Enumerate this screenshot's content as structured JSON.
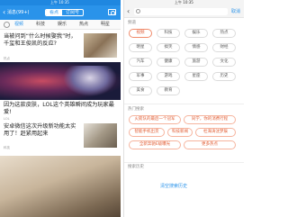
{
  "left": {
    "status_time": "上午 10:35",
    "header": {
      "message_label": "消息(99+)",
      "tabs": [
        "看点",
        "订阅号"
      ]
    },
    "categories": [
      "视频",
      "科技",
      "娱乐",
      "热点",
      "明星"
    ],
    "articles": [
      {
        "title": "当被问到“什么时候娶我”时，千玺和王俊凯的反应?",
        "source": "热点"
      },
      {
        "title": "因为这款皮肤，LOL这个英雄瞬间成为玩家最爱!",
        "source": "LOL"
      },
      {
        "title": "安卓微信这次升级新功能太实用了！赶紧用起来",
        "source": "科技"
      }
    ]
  },
  "right": {
    "status_time": "上午 10:35",
    "search": {
      "placeholder": "搜索",
      "cancel": "取消"
    },
    "channels_title": "频道",
    "channels": [
      "视频",
      "科技",
      "娱乐",
      "热点",
      "明星",
      "搞笑",
      "情感",
      "财经",
      "汽车",
      "健康",
      "旅游",
      "文化",
      "军事",
      "游戏",
      "星座",
      "历史",
      "美食",
      "教育"
    ],
    "hot_title": "热门搜索",
    "hot_searches": [
      "火箭队的最后一个冠军",
      "同学，你的消费行程",
      "智能手机出货",
      "科技新闻",
      "杜海涛沈梦辰",
      "全新奔驰E级曝光",
      "更多热点"
    ],
    "history_title": "搜索历史",
    "clear_history": "清空搜索历史"
  }
}
